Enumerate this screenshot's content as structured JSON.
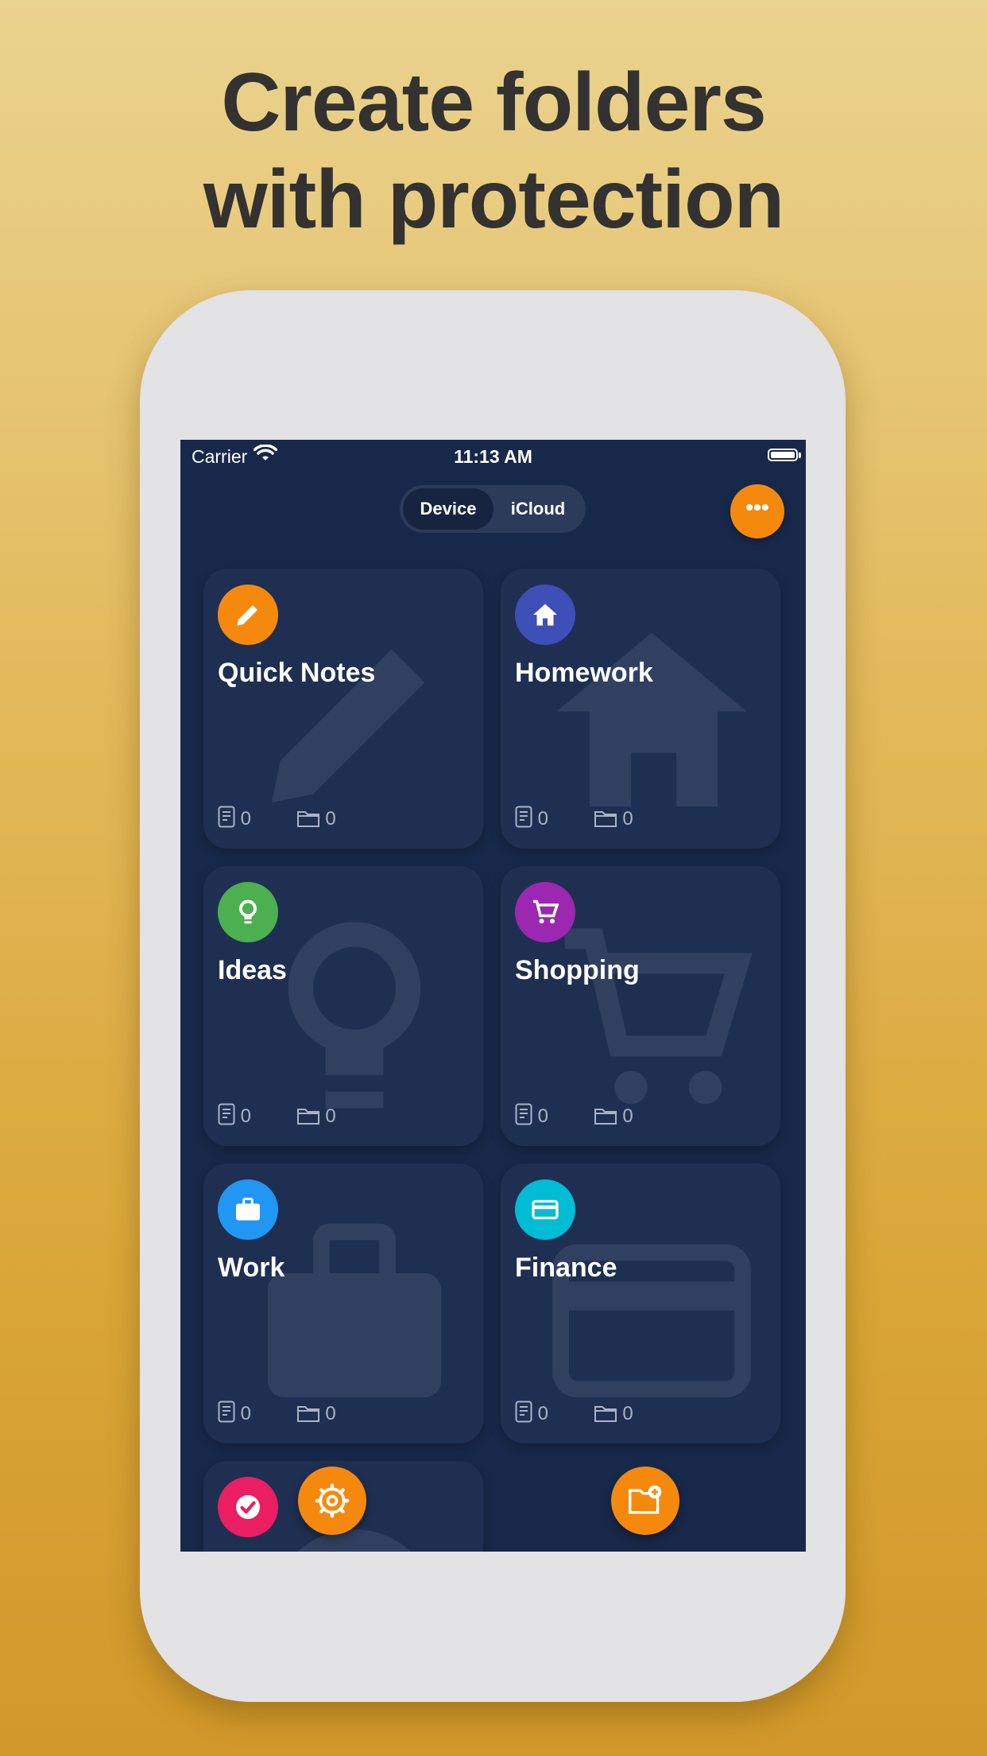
{
  "headline": {
    "line1": "Create folders",
    "line2": "with protection"
  },
  "status_bar": {
    "carrier": "Carrier",
    "time": "11:13 AM"
  },
  "segment": {
    "device": "Device",
    "icloud": "iCloud",
    "selected": "Device"
  },
  "more_button": {
    "label": "•••"
  },
  "folders": [
    {
      "title": "Quick Notes",
      "icon": "pencil-icon",
      "color": "#f5890e",
      "notes": "0",
      "subfolders": "0"
    },
    {
      "title": "Homework",
      "icon": "home-icon",
      "color": "#3f4fb8",
      "notes": "0",
      "subfolders": "0"
    },
    {
      "title": "Ideas",
      "icon": "lightbulb-icon",
      "color": "#4caf50",
      "notes": "0",
      "subfolders": "0"
    },
    {
      "title": "Shopping",
      "icon": "cart-icon",
      "color": "#9c27b0",
      "notes": "0",
      "subfolders": "0"
    },
    {
      "title": "Work",
      "icon": "briefcase-icon",
      "color": "#2196f3",
      "notes": "0",
      "subfolders": "0"
    },
    {
      "title": "Finance",
      "icon": "credit-card-icon",
      "color": "#00bcd4",
      "notes": "0",
      "subfolders": "0"
    },
    {
      "title": "",
      "icon": "checkmark-icon",
      "color": "#e91e63"
    }
  ],
  "fabs": {
    "settings": "gear-icon",
    "new_folder": "folder-add-icon",
    "color": "#f5890e"
  }
}
